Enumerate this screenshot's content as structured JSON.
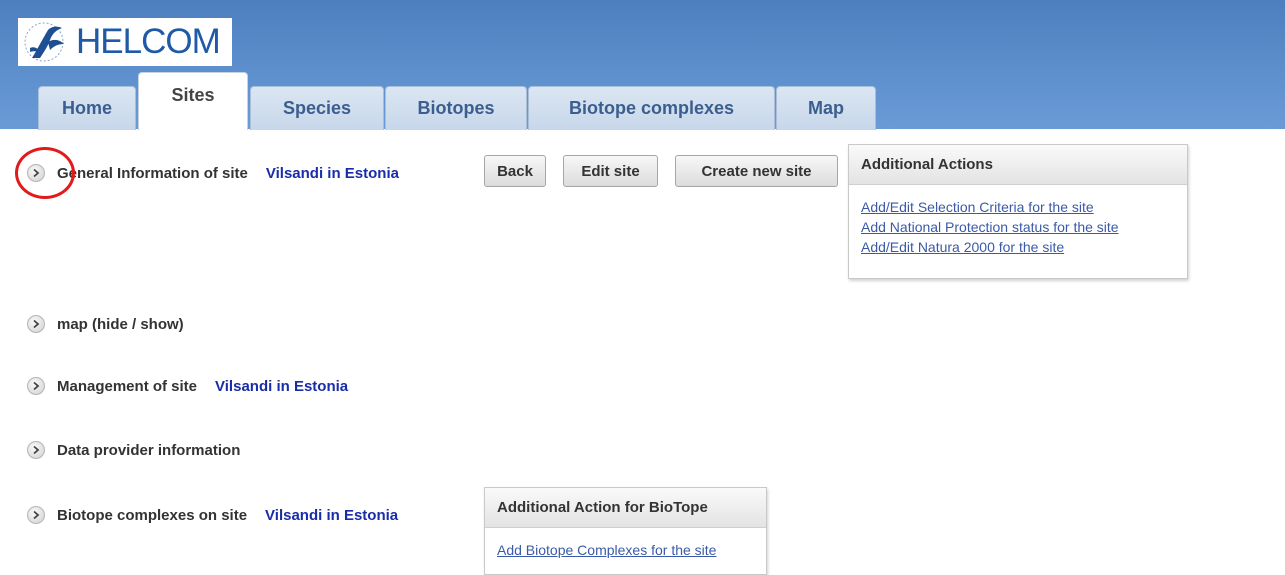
{
  "header": {
    "logo_text": "HELCOM",
    "logo_small_text": "HELCOM"
  },
  "tabs": [
    {
      "label": "Home",
      "active": false
    },
    {
      "label": "Sites",
      "active": true
    },
    {
      "label": "Species",
      "active": false
    },
    {
      "label": "Biotopes",
      "active": false
    },
    {
      "label": "Biotope complexes",
      "active": false
    },
    {
      "label": "Map",
      "active": false
    }
  ],
  "sections": {
    "general": {
      "label": "General Information of site",
      "site": "Vilsandi in Estonia"
    },
    "map": {
      "label": "map (hide / show)"
    },
    "management": {
      "label": "Management of site",
      "site": "Vilsandi in Estonia"
    },
    "data_provider": {
      "label": "Data provider information"
    },
    "biotope_complexes": {
      "label": "Biotope complexes on site",
      "site": "Vilsandi in Estonia"
    }
  },
  "buttons": {
    "back": "Back",
    "edit_site": "Edit site",
    "create_new_site": "Create new site"
  },
  "additional_actions": {
    "title": "Additional Actions",
    "links": [
      "Add/Edit Selection Criteria for the site",
      "Add National Protection status for the site",
      "Add/Edit Natura 2000 for the site"
    ]
  },
  "biotope_actions": {
    "title": "Additional Action for BioTope",
    "links": [
      "Add Biotope Complexes for the site"
    ]
  },
  "colors": {
    "banner": "#5d8fcd",
    "link": "#3a5aa8",
    "site_name": "#1a2da8",
    "highlight": "#e11b1b"
  }
}
